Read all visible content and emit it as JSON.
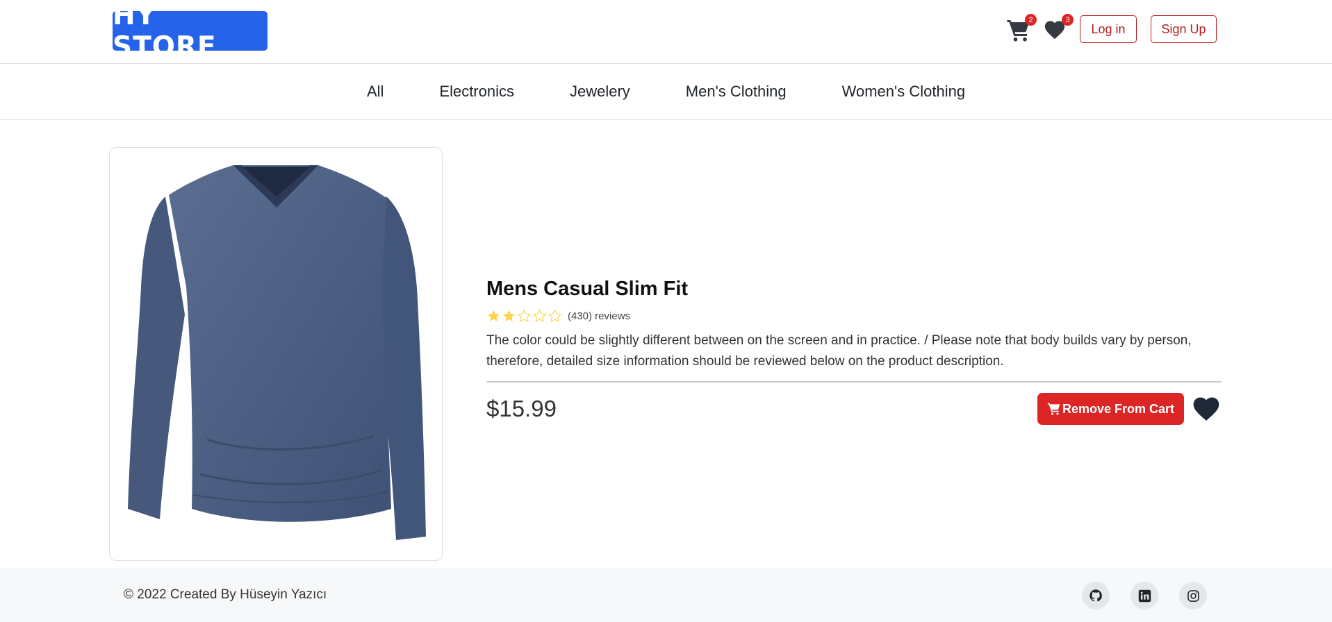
{
  "header": {
    "logo": "HY STORE",
    "cart_count": "2",
    "wishlist_count": "3",
    "login_label": "Log in",
    "signup_label": "Sign Up",
    "cart_icon": "cart-icon",
    "wishlist_icon": "heart-icon"
  },
  "categories": [
    "All",
    "Electronics",
    "Jewelery",
    "Men's Clothing",
    "Women's Clothing"
  ],
  "product": {
    "title": "Mens Casual Slim Fit",
    "rating": 2,
    "rating_max": 5,
    "reviews": "(430) reviews",
    "description": "The color could be slightly different between on the screen and in practice. / Please note that body builds vary by person, therefore, detailed size information should be reviewed below on the product description.",
    "price": "$15.99",
    "cart_button_label": "Remove From Cart",
    "image_subject": "blue long-sleeve v-neck t-shirt"
  },
  "footer": {
    "copyright": "© 2022 Created By Hüseyin Yazıcı",
    "social": [
      "github-icon",
      "linkedin-icon",
      "instagram-icon"
    ]
  },
  "colors": {
    "brand": "#2563eb",
    "danger": "#dc2626",
    "star": "#fcd34d",
    "shirt": "#4b5f82"
  }
}
